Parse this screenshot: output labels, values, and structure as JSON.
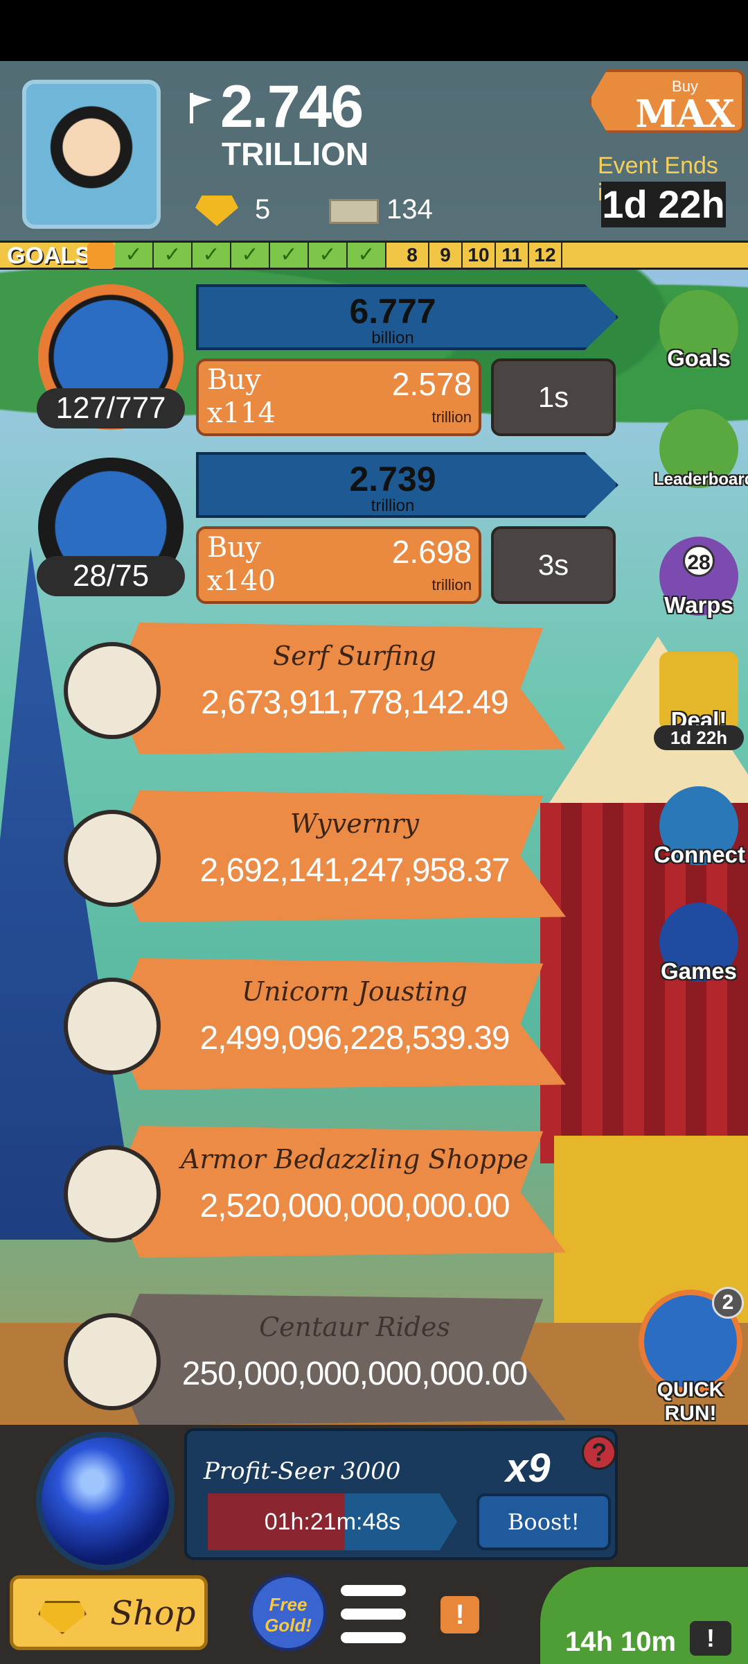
{
  "hud": {
    "cash_value": "2.746",
    "cash_unit": "TRILLION",
    "gold_count": "5",
    "tickets_count": "134",
    "buy_label_top": "Buy",
    "buy_label_main": "MAX",
    "event_label": "Event Ends in:",
    "event_time": "1d 22h"
  },
  "goals": {
    "label": "GOALS",
    "completed_mark": "✓",
    "completed_count": 7,
    "upcoming": [
      "8",
      "9",
      "10",
      "11",
      "12"
    ]
  },
  "managers": [
    {
      "count": "127/777",
      "profit_value": "6.777",
      "profit_unit": "billion",
      "buy_label": "Buy",
      "buy_qty": "x114",
      "cost": "2.578",
      "cost_unit": "trillion",
      "timer": "1s"
    },
    {
      "count": "28/75",
      "profit_value": "2.739",
      "profit_unit": "trillion",
      "buy_label": "Buy",
      "buy_qty": "x140",
      "cost": "2.698",
      "cost_unit": "trillion",
      "timer": "3s"
    }
  ],
  "businesses": [
    {
      "name": "Serf Surfing",
      "value": "2,673,911,778,142.49"
    },
    {
      "name": "Wyvernry",
      "value": "2,692,141,247,958.37"
    },
    {
      "name": "Unicorn Jousting",
      "value": "2,499,096,228,539.39"
    },
    {
      "name": "Armor Bedazzling Shoppe",
      "value": "2,520,000,000,000.00"
    },
    {
      "name": "Centaur Rides",
      "value": "250,000,000,000,000.00"
    }
  ],
  "side_menu": {
    "goals": "Goals",
    "leaderboard": "Leaderboard",
    "warps_count": "28",
    "warps": "Warps",
    "deal": "Deal!",
    "deal_time": "1d 22h",
    "connect": "Connect",
    "games": "Games"
  },
  "quick_run": {
    "count": "2",
    "label": "QUICK RUN!"
  },
  "seer": {
    "name": "Profit-Seer 3000",
    "multiplier": "x9",
    "help": "?",
    "timer": "01h:21m:48s",
    "progress": 0.55,
    "boost": "Boost!"
  },
  "bottom": {
    "shop": "Shop",
    "free_gold": "Free Gold!",
    "alert": "!",
    "timer": "14h 10m",
    "tv_mark": "!"
  },
  "colors": {
    "banner_orange": "#ec8b45",
    "profit_blue": "#1d5a93",
    "goal_green": "#7ec64a",
    "goal_yellow": "#f1c644"
  },
  "icons": [
    "flag-icon",
    "gold-bar-icon",
    "ticket-icon",
    "gift-icon",
    "clipboard-icon",
    "trophy-icon",
    "warp-clock-icon",
    "gift-box-icon",
    "cards-icon",
    "world-map-icon",
    "crystal-ball-icon",
    "gem-icon",
    "menu-icon",
    "alert-icon",
    "tv-icon"
  ]
}
